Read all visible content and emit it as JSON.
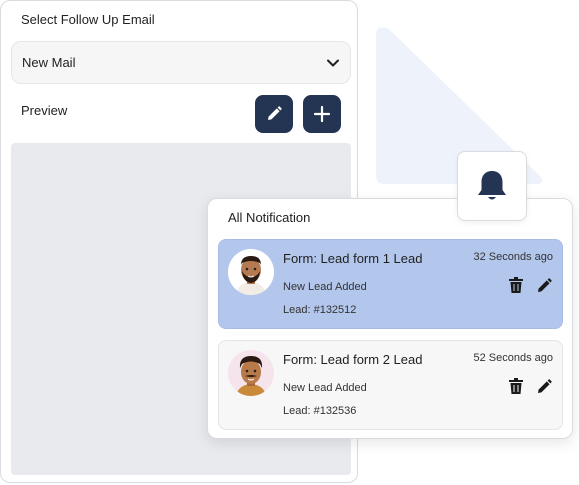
{
  "email_panel": {
    "title": "Select Follow Up Email",
    "select": {
      "value": "New Mail"
    },
    "preview_label": "Preview"
  },
  "notifications": {
    "title": "All Notification",
    "items": [
      {
        "heading": "Form: Lead form 1 Lead",
        "time": "32 Seconds ago",
        "subtitle": "New Lead Added",
        "lead": "Lead: #132512",
        "highlighted": true
      },
      {
        "heading": "Form: Lead form 2 Lead",
        "time": "52 Seconds ago",
        "subtitle": "New Lead Added",
        "lead": "Lead: #132536",
        "highlighted": false
      }
    ]
  },
  "icons": [
    "chevron-down-icon",
    "pencil-icon",
    "plus-icon",
    "bell-icon",
    "trash-icon"
  ],
  "colors": {
    "primary_button": "#243553",
    "highlight_card": "#b3c6ec",
    "preview_area": "#e8eaee",
    "deco_shape": "#eef2fb"
  }
}
